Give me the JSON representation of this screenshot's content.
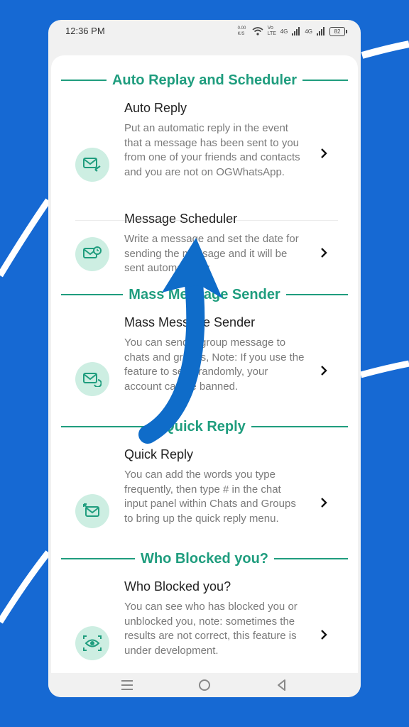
{
  "status_bar": {
    "time": "12:36 PM",
    "net_speed": "0.00 K/S",
    "volte": "Vo LTE",
    "signal1": "4G",
    "signal2": "4G",
    "battery": "82"
  },
  "sections": [
    {
      "title": "Auto Replay and Scheduler"
    },
    {
      "title": "Mass Message Sender"
    },
    {
      "title": "Quick Reply"
    },
    {
      "title": "Who Blocked you?"
    }
  ],
  "items": [
    {
      "title": "Auto Reply",
      "desc": "Put an automatic reply in the event that a message has been sent to you from one of your friends and contacts and you are not on OGWhatsApp.",
      "icon": "auto-reply-icon"
    },
    {
      "title": "Message Scheduler",
      "desc": "Write a message and set the date for sending the message and it will be sent automatically",
      "icon": "message-scheduler-icon"
    },
    {
      "title": "Mass Message Sender",
      "desc": "You can send a group message to chats and groups, Note: If you use the feature to send randomly, your account can be banned.",
      "icon": "mass-message-icon"
    },
    {
      "title": "Quick Reply",
      "desc": "You can add the words you type frequently, then type # in the chat input panel within Chats and Groups to bring up the quick reply menu.",
      "icon": "quick-reply-icon"
    },
    {
      "title": "Who Blocked you?",
      "desc": "You can see who has blocked you or unblocked you, note: sometimes the results are not correct, this feature is under development.",
      "icon": "eye-icon"
    }
  ],
  "colors": {
    "accent": "#1f9d7e",
    "icon_bg": "#cdeee2",
    "background": "#1669d3",
    "arrow": "#0f6cc9"
  },
  "nav": {
    "buttons": [
      "menu-icon",
      "home-icon",
      "back-icon"
    ]
  }
}
